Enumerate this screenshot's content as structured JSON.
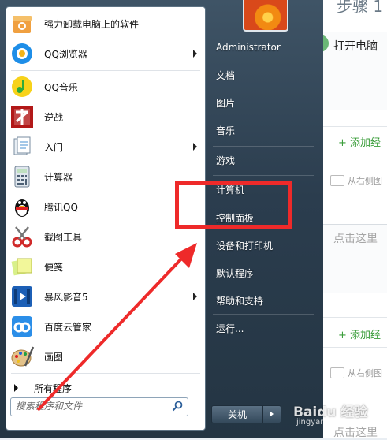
{
  "background_page": {
    "title": "步骤 1",
    "step_text": "打开电脑",
    "add_label_1": "+ 添加经",
    "hint_1": "从右侧图",
    "click_hint_1": "点击这里",
    "add_label_2": "+ 添加经",
    "hint_2": "从右侧图",
    "click_hint_2": "点击这里"
  },
  "programs": [
    {
      "label": "强力卸载电脑上的软件",
      "icon": "uninstall-box-icon",
      "submenu": false
    },
    {
      "label": "QQ浏览器",
      "icon": "qq-browser-icon",
      "submenu": true
    },
    {
      "label": "QQ音乐",
      "icon": "qq-music-icon",
      "submenu": false
    },
    {
      "label": "逆战",
      "icon": "nizhan-game-icon",
      "submenu": false
    },
    {
      "label": "入门",
      "icon": "getting-started-icon",
      "submenu": true
    },
    {
      "label": "计算器",
      "icon": "calculator-icon",
      "submenu": false
    },
    {
      "label": "腾讯QQ",
      "icon": "qq-penguin-icon",
      "submenu": false
    },
    {
      "label": "截图工具",
      "icon": "snipping-tool-icon",
      "submenu": false
    },
    {
      "label": "便笺",
      "icon": "sticky-notes-icon",
      "submenu": false
    },
    {
      "label": "暴风影音5",
      "icon": "baofeng-player-icon",
      "submenu": true
    },
    {
      "label": "百度云管家",
      "icon": "baidu-cloud-icon",
      "submenu": false
    },
    {
      "label": "画图",
      "icon": "paint-palette-icon",
      "submenu": false
    }
  ],
  "all_programs": "所有程序",
  "search": {
    "placeholder": "搜索程序和文件"
  },
  "right_panel": [
    {
      "label": "Administrator"
    },
    {
      "label": "文档"
    },
    {
      "label": "图片"
    },
    {
      "label": "音乐"
    },
    {
      "label": "游戏"
    },
    {
      "label": "计算机"
    },
    {
      "label": "控制面板"
    },
    {
      "label": "设备和打印机"
    },
    {
      "label": "默认程序"
    },
    {
      "label": "帮助和支持"
    },
    {
      "label": "运行..."
    }
  ],
  "shutdown": {
    "label": "关机"
  },
  "watermark": {
    "text": "Baidu 经验",
    "sub": "jingyan.baidu.com"
  },
  "colors": {
    "highlight": "#ee2a2a",
    "menu_bg": "#2b3d4e",
    "accent_green": "#3a9d3a"
  }
}
